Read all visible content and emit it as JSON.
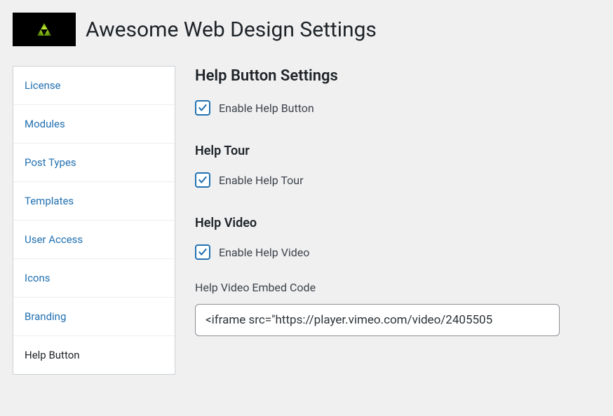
{
  "header": {
    "title": "Awesome Web Design Settings"
  },
  "sidebar": {
    "items": [
      {
        "label": "License"
      },
      {
        "label": "Modules"
      },
      {
        "label": "Post Types"
      },
      {
        "label": "Templates"
      },
      {
        "label": "User Access"
      },
      {
        "label": "Icons"
      },
      {
        "label": "Branding"
      },
      {
        "label": "Help Button"
      }
    ]
  },
  "content": {
    "heading_main": "Help Button Settings",
    "enable_help_button_label": "Enable Help Button",
    "enable_help_button_checked": true,
    "heading_tour": "Help Tour",
    "enable_help_tour_label": "Enable Help Tour",
    "enable_help_tour_checked": true,
    "heading_video": "Help Video",
    "enable_help_video_label": "Enable Help Video",
    "enable_help_video_checked": true,
    "embed_code_label": "Help Video Embed Code",
    "embed_code_value": "<iframe src=\"https://player.vimeo.com/video/2405505"
  }
}
